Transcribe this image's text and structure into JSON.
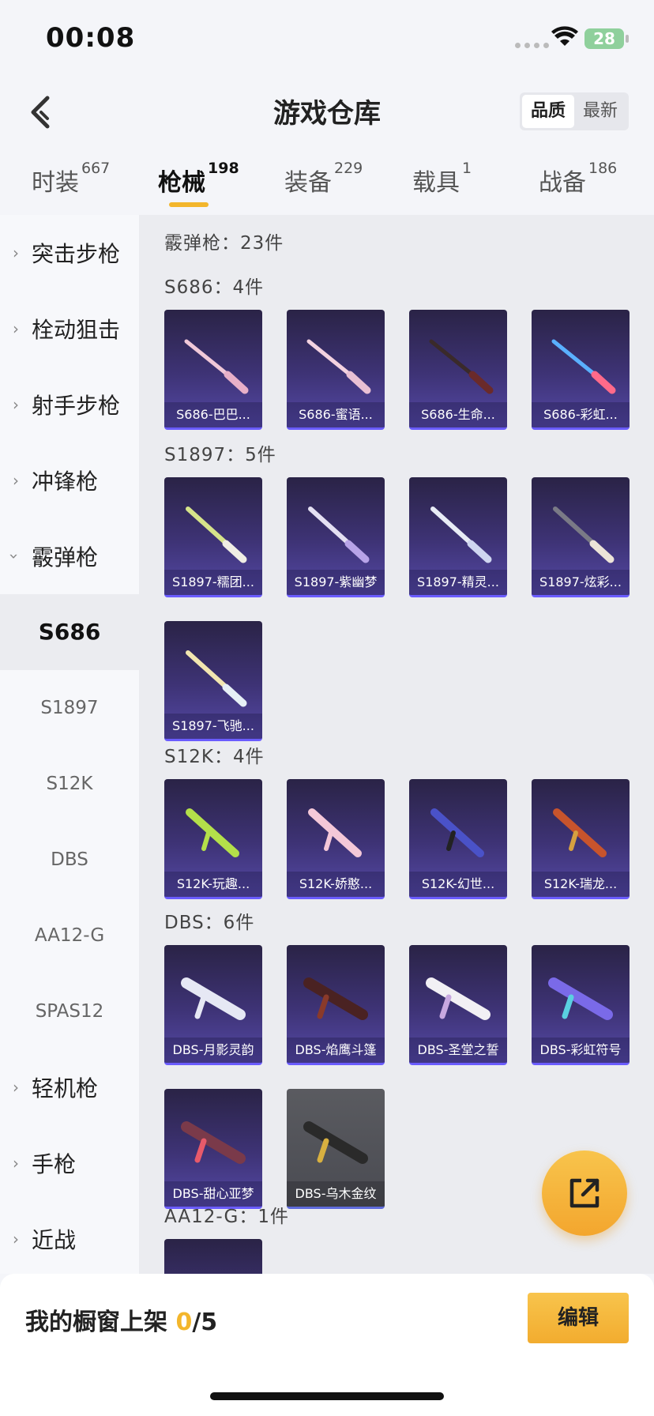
{
  "status_bar": {
    "time": "00:08",
    "battery": "28"
  },
  "header": {
    "title": "游戏仓库",
    "sort": [
      "品质",
      "最新"
    ]
  },
  "tabs": [
    {
      "label": "时装",
      "count": "667"
    },
    {
      "label": "枪械",
      "count": "198"
    },
    {
      "label": "装备",
      "count": "229"
    },
    {
      "label": "载具",
      "count": "1"
    },
    {
      "label": "战备",
      "count": "186"
    }
  ],
  "sidebar": {
    "categories": [
      "突击步枪",
      "栓动狙击",
      "射手步枪",
      "冲锋枪",
      "霰弹枪",
      "轻机枪",
      "手枪",
      "近战"
    ],
    "subitems": [
      "S686",
      "S1897",
      "S12K",
      "DBS",
      "AA12-G",
      "SPAS12"
    ]
  },
  "content": {
    "category_title": "霰弹枪：23件",
    "sections": [
      {
        "title": "S686：4件",
        "items": [
          "S686-巴巴...",
          "S686-蜜语...",
          "S686-生命...",
          "S686-彩虹..."
        ]
      },
      {
        "title": "S1897：5件",
        "items": [
          "S1897-糯团...",
          "S1897-紫幽梦",
          "S1897-精灵...",
          "S1897-炫彩...",
          "S1897-飞驰..."
        ]
      },
      {
        "title": "S12K：4件",
        "items": [
          "S12K-玩趣...",
          "S12K-娇憨...",
          "S12K-幻世...",
          "S12K-瑞龙..."
        ]
      },
      {
        "title": "DBS：6件",
        "items": [
          "DBS-月影灵韵",
          "DBS-焰鹰斗篷",
          "DBS-圣堂之誓",
          "DBS-彩虹符号",
          "DBS-甜心亚梦",
          "DBS-乌木金纹"
        ]
      },
      {
        "title": "AA12-G：1件",
        "items": []
      }
    ]
  },
  "bottom": {
    "label": "我的橱窗上架 ",
    "current": "0",
    "total": "/5",
    "edit": "编辑"
  },
  "colors": {
    "accent": "#f3b62c",
    "card_top": "#2a2346",
    "card_bottom": "#5549a6"
  }
}
